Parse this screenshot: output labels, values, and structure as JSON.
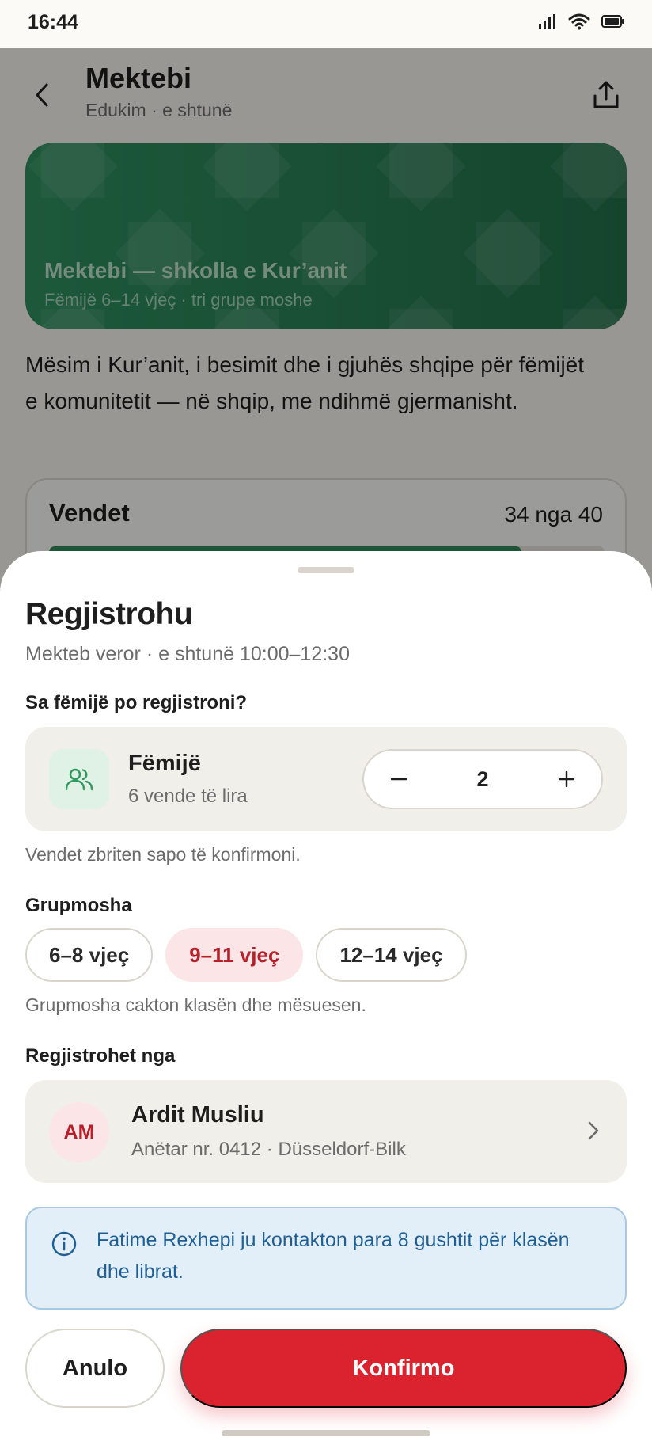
{
  "status_bar": {
    "time": "16:44"
  },
  "header": {
    "title": "Mektebi",
    "subtitle": "Edukim · e shtunë"
  },
  "hero": {
    "title": "Mektebi — shkolla e Kur’anit",
    "subtitle": "Fëmijë 6–14 vjeç · tri grupe moshe"
  },
  "description": "Mësim i Kur’anit, i besimit dhe i gjuhës shqipe për fëmijët e komunitetit — në shqip, me ndihmë gjermanisht.",
  "seats": {
    "label": "Vendet",
    "count_text": "34 nga 40",
    "taken": 34,
    "total": 40
  },
  "sheet": {
    "title": "Regjistrohu",
    "subtitle": "Mekteb veror · e shtunë 10:00–12:30",
    "children_question": "Sa fëmijë po regjistroni?",
    "children": {
      "title": "Fëmijë",
      "subtitle": "6 vende të lira",
      "value": "2"
    },
    "seats_note": "Vendet zbriten sapo të konfirmoni.",
    "age_label": "Grupmosha",
    "age_options": [
      {
        "label": "6–8 vjeç",
        "selected": false
      },
      {
        "label": "9–11 vjeç",
        "selected": true
      },
      {
        "label": "12–14 vjeç",
        "selected": false
      }
    ],
    "age_note": "Grupmosha cakton klasën dhe mësuesen.",
    "registered_by_label": "Regjistrohet nga",
    "member": {
      "initials": "AM",
      "name": "Ardit Musliu",
      "meta": "Anëtar nr. 0412 · Düsseldorf-Bilk"
    },
    "info": "Fatime Rexhepi ju kontakton para 8 gushtit për klasën dhe librat.",
    "cancel_label": "Anulo",
    "confirm_label": "Konfirmo"
  },
  "colors": {
    "accent_red": "#db2330",
    "hero_green": "#2a8257",
    "info_blue": "#1f5f94"
  }
}
